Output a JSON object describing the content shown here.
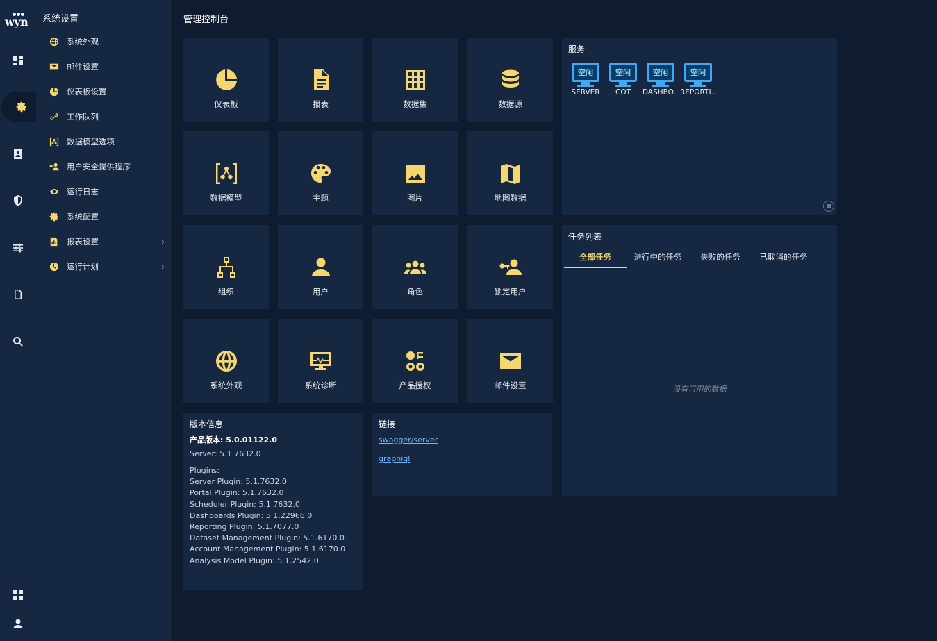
{
  "app": {
    "logo_text": "wyn"
  },
  "sidebar": {
    "title": "系统设置",
    "items": [
      {
        "label": "系统外观",
        "icon": "globe-icon"
      },
      {
        "label": "邮件设置",
        "icon": "envelope-icon"
      },
      {
        "label": "仪表板设置",
        "icon": "pie-chart-icon"
      },
      {
        "label": "工作队列",
        "icon": "link-icon"
      },
      {
        "label": "数据模型选项",
        "icon": "data-model-icon"
      },
      {
        "label": "用户安全提供程序",
        "icon": "user-key-icon"
      },
      {
        "label": "运行日志",
        "icon": "eye-icon"
      },
      {
        "label": "系统配置",
        "icon": "gear-icon"
      },
      {
        "label": "报表设置",
        "icon": "report-icon",
        "has_children": true
      },
      {
        "label": "运行计划",
        "icon": "clock-icon",
        "has_children": true
      }
    ]
  },
  "rail": {
    "items": [
      "dashboard-icon",
      "settings-icon",
      "contact-card-icon",
      "shield-icon",
      "sliders-icon",
      "document-icon",
      "search-icon"
    ],
    "active": "settings-icon",
    "bottom": [
      "apps-grid-icon",
      "user-icon"
    ]
  },
  "main": {
    "title": "管理控制台",
    "tiles": [
      "仪表板",
      "报表",
      "数据集",
      "数据源",
      "数据模型",
      "主题",
      "图片",
      "地图数据",
      "组织",
      "用户",
      "角色",
      "锁定用户",
      "系统外观",
      "系统诊断",
      "产品授权",
      "邮件设置"
    ],
    "services": {
      "title": "服务",
      "status_label": "空闲",
      "items": [
        "SERVER",
        "COT",
        "DASHBO...",
        "REPORTI..."
      ]
    },
    "tasks": {
      "title": "任务列表",
      "tabs": [
        "全部任务",
        "进行中的任务",
        "失败的任务",
        "已取消的任务"
      ],
      "active_tab": "全部任务",
      "empty_text": "没有可用的数据"
    },
    "version": {
      "title": "版本信息",
      "product": "产品版本: 5.0.01122.0",
      "server": "Server: 5.1.7632.0",
      "plugins_label": "Plugins:",
      "plugins": [
        "Server Plugin: 5.1.7632.0",
        "Portal Plugin: 5.1.7632.0",
        "Scheduler Plugin: 5.1.7632.0",
        "Dashboards Plugin: 5.1.22966.0",
        "Reporting Plugin: 5.1.7077.0",
        "Dataset Management Plugin: 5.1.6170.0",
        "Account Management Plugin: 5.1.6170.0",
        "Analysis Model Plugin: 5.1.2542.0"
      ]
    },
    "links": {
      "title": "链接",
      "items": [
        "swagger/server",
        "graphiql"
      ]
    }
  },
  "colors": {
    "accent": "#f5d76e",
    "panel": "#152741",
    "background": "#0f1c30",
    "service": "#3fa9f5"
  }
}
